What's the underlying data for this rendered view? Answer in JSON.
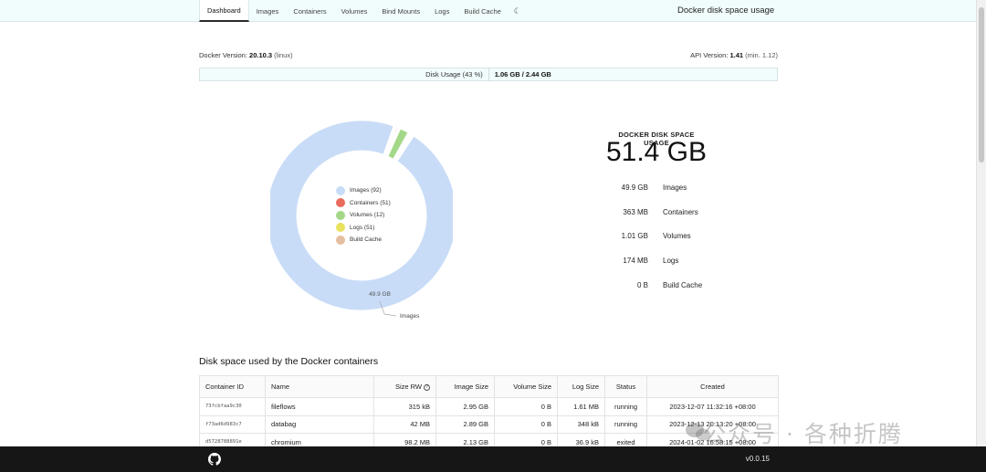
{
  "nav": {
    "tabs": [
      "Dashboard",
      "Images",
      "Containers",
      "Volumes",
      "Bind Mounts",
      "Logs",
      "Build Cache"
    ],
    "active_tab": "Dashboard",
    "theme_icon": "moon-icon",
    "title": "Docker disk space usage"
  },
  "meta": {
    "docker_version_label": "Docker Version:",
    "docker_version": "20.10.3",
    "docker_os": "(linux)",
    "api_version_label": "API Version:",
    "api_version": "1.41",
    "api_min": "(min. 1.12)"
  },
  "disk_usage": {
    "label": "Disk Usage (43 %)",
    "value": "1.06 GB / 2.44 GB",
    "percent": 43
  },
  "chart_data": {
    "type": "pie",
    "categories": [
      "Images",
      "Containers",
      "Volumes",
      "Logs",
      "Build Cache"
    ],
    "values": [
      49.9,
      0.363,
      1.01,
      0.174,
      0
    ],
    "unit": "GB",
    "legend_labels": [
      "Images (92)",
      "Containers (51)",
      "Volumes (12)",
      "Logs (51)",
      "Build Cache"
    ],
    "colors": [
      "#c9dcf7",
      "#e96b5d",
      "#a4d889",
      "#e9e25f",
      "#e4bf9f"
    ],
    "slice_label": "49.9 GB",
    "callout_label": "Images"
  },
  "summary": {
    "heading": "DOCKER DISK SPACE USAGE",
    "total": "51.4 GB",
    "rows": [
      {
        "value": "49.9 GB",
        "label": "Images"
      },
      {
        "value": "363 MB",
        "label": "Containers"
      },
      {
        "value": "1.01 GB",
        "label": "Volumes"
      },
      {
        "value": "174 MB",
        "label": "Logs"
      },
      {
        "value": "0 B",
        "label": "Build Cache"
      }
    ]
  },
  "containers_section": {
    "title": "Disk space used by the Docker containers",
    "headers": [
      "Container ID",
      "Name",
      "Size RW",
      "Image Size",
      "Volume Size",
      "Log Size",
      "Status",
      "Created"
    ],
    "rows": [
      [
        "73fcbfaa9c30",
        "fileflows",
        "315 kB",
        "2.95 GB",
        "0 B",
        "1.61 MB",
        "running",
        "2023-12-07 11:32:16 +08:00"
      ],
      [
        "f73ad6d983c7",
        "databag",
        "42 MB",
        "2.89 GB",
        "0 B",
        "348 kB",
        "running",
        "2023-12-13 20:13:20 +08:00"
      ],
      [
        "d5728788891e",
        "chromium",
        "98.2 MB",
        "2.13 GB",
        "0 B",
        "36.9 kB",
        "exited",
        "2024-01-02 16:58:15 +08:00"
      ]
    ]
  },
  "footer": {
    "github_icon": "github-icon",
    "version": "v0.0.15"
  },
  "watermark": "公众号 · 各种折腾"
}
